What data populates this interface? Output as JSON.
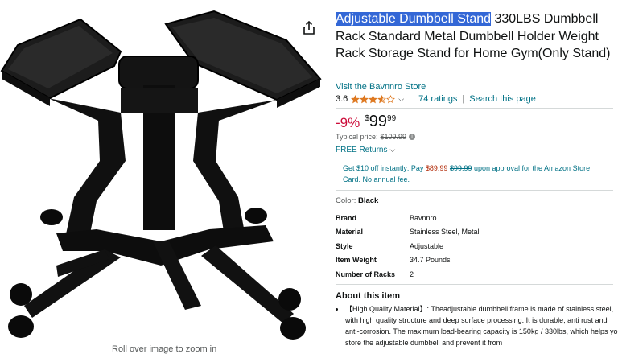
{
  "image_pane": {
    "rollover_text": "Roll over image to zoom in"
  },
  "product": {
    "title_highlight": "Adjustable Dumbbell Stand",
    "title_rest": " 330LBS Dumbbell Rack Standard Metal Dumbbell Holder Weight Rack Storage Stand for Home Gym(Only Stand)",
    "store_link": "Visit the Bavnnro Store",
    "rating_value": "3.6",
    "rating_stars": 3.6,
    "ratings_count": "74 ratings",
    "search_page": "Search this page",
    "discount": "-9%",
    "price_currency": "$",
    "price_whole": "99",
    "price_fraction": "99",
    "typical_label": "Typical price:",
    "typical_price": "$109.99",
    "free_returns": "FREE Returns",
    "promo_a": "Get $10 off instantly: Pay ",
    "promo_price": "$89.99",
    "promo_old": "$99.99",
    "promo_b": " upon approval for the Amazon Store Card. No annual fee.",
    "color_label": "Color: ",
    "color_value": "Black"
  },
  "specs": [
    {
      "key": "Brand",
      "value": "Bavnnro"
    },
    {
      "key": "Material",
      "value": "Stainless Steel, Metal"
    },
    {
      "key": "Style",
      "value": "Adjustable"
    },
    {
      "key": "Item Weight",
      "value": "34.7 Pounds"
    },
    {
      "key": "Number of Racks",
      "value": "2"
    }
  ],
  "about": {
    "title": "About this item",
    "bullet1": "【High Quality Material】: Theadjustable dumbbell frame is made of stainless steel, with high quality structure and deep surface processing. It is durable, anti rust and anti-corrosion. The maximum load-bearing capacity is 150kg / 330lbs, which helps you store the adjustable dumbbell and prevent it from"
  },
  "colors": {
    "link": "#007185",
    "deal_red": "#cc0c39",
    "star_orange": "#de7921",
    "selection": "#3367d6"
  },
  "icons": [
    "share-icon",
    "star-icon",
    "chevron-down-icon",
    "info-icon"
  ]
}
